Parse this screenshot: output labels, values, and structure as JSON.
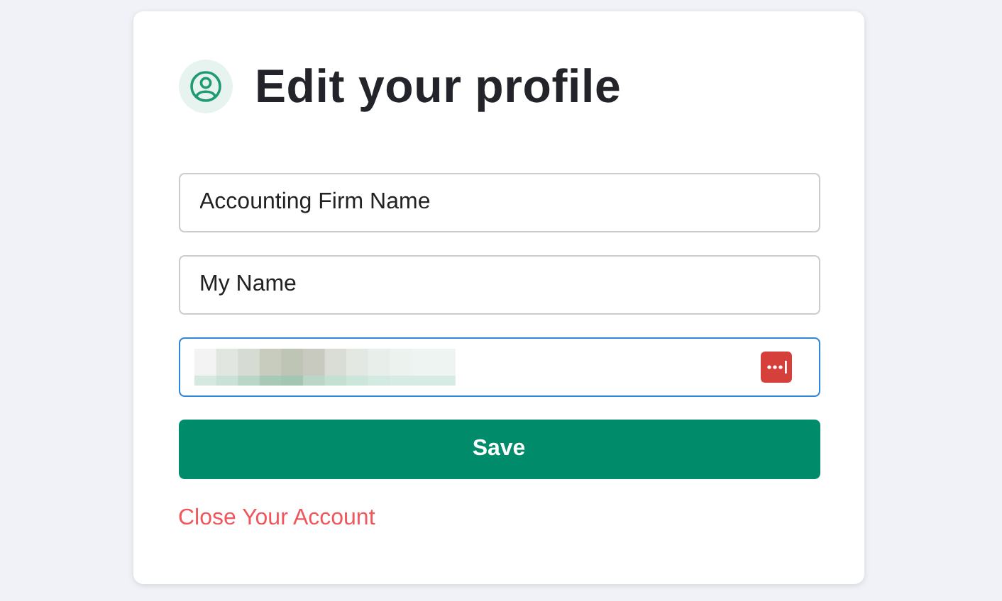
{
  "title": "Edit your profile",
  "fields": [
    {
      "kind": "text",
      "value": "Accounting Firm Name",
      "focused": false
    },
    {
      "kind": "text",
      "value": "My Name",
      "focused": false
    },
    {
      "kind": "redacted",
      "focused": true,
      "password_manager": true
    }
  ],
  "save_button": "Save",
  "close_link": "Close Your Account"
}
